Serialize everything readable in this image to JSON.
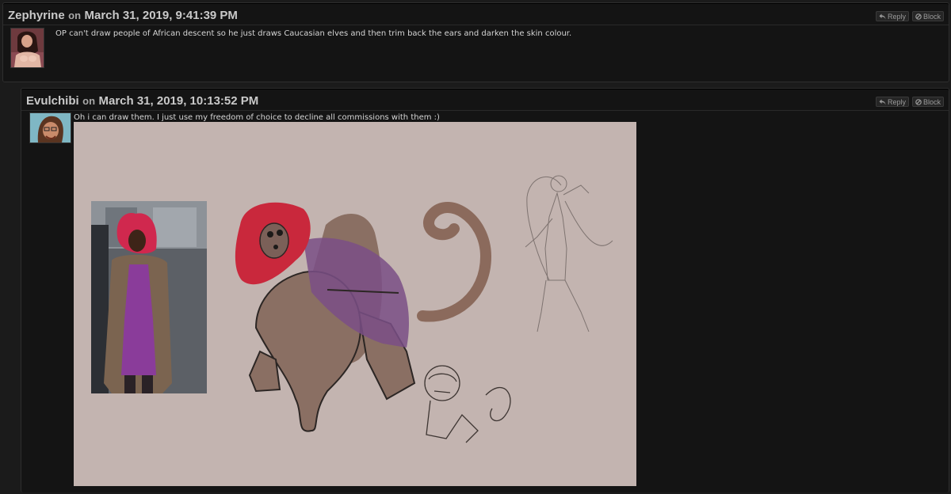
{
  "posts": [
    {
      "author": "Zephyrine",
      "on": "on",
      "date": "March 31, 2019, 9:41:39 PM",
      "reply_label": "Reply",
      "block_label": "Block",
      "text": "OP can't draw people of African descent so he just draws Caucasian elves and then trim back the ears and darken the skin colour."
    },
    {
      "author": "Evulchibi",
      "on": "on",
      "date": "March 31, 2019, 10:13:52 PM",
      "reply_label": "Reply",
      "block_label": "Block",
      "text": "Oh i can draw them. I just use my freedom of choice to decline all commissions with them :)"
    }
  ],
  "icons": {
    "reply": "reply-arrow-icon",
    "block": "block-circle-icon"
  },
  "colors": {
    "page_bg": "#1b1b1b",
    "post_bg": "#141414",
    "sketch_bg": "#c3b4b0"
  }
}
